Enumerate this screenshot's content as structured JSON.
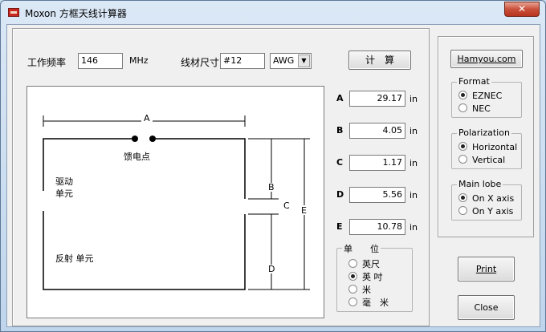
{
  "window": {
    "title": "Moxon 方框天线计算器",
    "close_glyph": "✕",
    "icon": "app-icon"
  },
  "inputs": {
    "freq_label": "工作频率",
    "freq_value": "146",
    "freq_unit": "MHz",
    "wire_label": "线材尺寸",
    "wire_value": "#12",
    "wire_type_selected": "AWG",
    "calc_button": "计　算"
  },
  "diagram": {
    "labels": {
      "A": "A",
      "B": "B",
      "C": "C",
      "D": "D",
      "E": "E"
    },
    "feed_point": "馈电点",
    "driven_line1": "驱动",
    "driven_line2": "单元",
    "reflector": "反射 单元"
  },
  "results": [
    {
      "letter": "A",
      "value": "29.17",
      "unit": "in"
    },
    {
      "letter": "B",
      "value": "4.05",
      "unit": "in"
    },
    {
      "letter": "C",
      "value": "1.17",
      "unit": "in"
    },
    {
      "letter": "D",
      "value": "5.56",
      "unit": "in"
    },
    {
      "letter": "E",
      "value": "10.78",
      "unit": "in"
    }
  ],
  "units_group": {
    "title": "单　　位",
    "options": [
      {
        "label": "英尺",
        "selected": false
      },
      {
        "label": "英 吋",
        "selected": true
      },
      {
        "label": "米",
        "selected": false
      },
      {
        "label": "毫　米",
        "selected": false
      }
    ]
  },
  "side": {
    "hamyou_button": "Hamyou.com",
    "format": {
      "title": "Format",
      "options": [
        {
          "label": "EZNEC",
          "selected": true
        },
        {
          "label": "NEC",
          "selected": false
        }
      ]
    },
    "polarization": {
      "title": "Polarization",
      "options": [
        {
          "label": "Horizontal",
          "selected": true
        },
        {
          "label": "Vertical",
          "selected": false
        }
      ]
    },
    "main_lobe": {
      "title": "Main lobe",
      "options": [
        {
          "label": "On X axis",
          "selected": true
        },
        {
          "label": "On Y axis",
          "selected": false
        }
      ]
    },
    "print_button": "Print",
    "close_button": "Close"
  }
}
